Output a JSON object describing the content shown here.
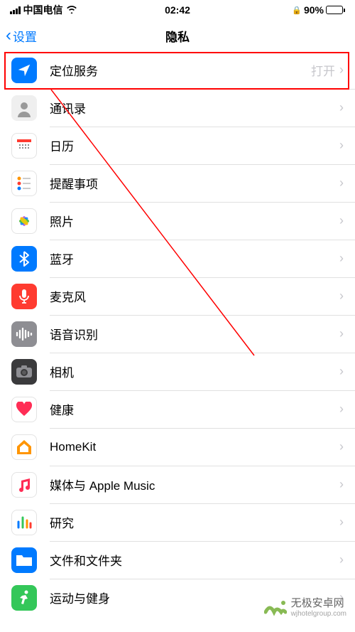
{
  "status_bar": {
    "carrier": "中国电信",
    "time": "02:42",
    "battery_pct": "90%"
  },
  "nav": {
    "back_label": "设置",
    "title": "隐私"
  },
  "rows": {
    "location": {
      "label": "定位服务",
      "value": "打开"
    },
    "contacts": {
      "label": "通讯录"
    },
    "calendar": {
      "label": "日历"
    },
    "reminders": {
      "label": "提醒事项"
    },
    "photos": {
      "label": "照片"
    },
    "bluetooth": {
      "label": "蓝牙"
    },
    "microphone": {
      "label": "麦克风"
    },
    "speech": {
      "label": "语音识别"
    },
    "camera": {
      "label": "相机"
    },
    "health": {
      "label": "健康"
    },
    "homekit": {
      "label": "HomeKit"
    },
    "music": {
      "label": "媒体与 Apple Music"
    },
    "research": {
      "label": "研究"
    },
    "files": {
      "label": "文件和文件夹"
    },
    "fitness": {
      "label": "运动与健身"
    }
  },
  "watermark": {
    "main": "无极安卓网",
    "sub": "wjhotelgroup.com"
  }
}
